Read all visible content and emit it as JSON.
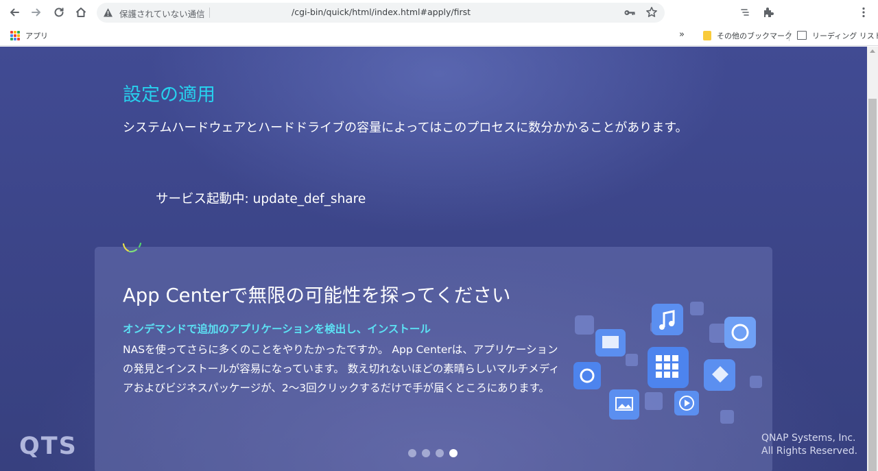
{
  "browser": {
    "security_label": "保護されていない通信",
    "url": "/cgi-bin/quick/html/index.html#apply/first",
    "bookmarks": {
      "apps_label": "アプリ",
      "overflow_label": "»",
      "other_bookmarks_label": "その他のブックマーク",
      "reading_list_label": "リーディング リスト"
    },
    "apps_icon_colors": [
      "#ea4335",
      "#fbbc04",
      "#34a853",
      "#4285f4",
      "#ea4335",
      "#fbbc04",
      "#34a853",
      "#4285f4",
      "#ea4335"
    ]
  },
  "page": {
    "heading": "設定の適用",
    "description": "システムハードウェアとハードドライブの容量によってはこのプロセスに数分かかることがあります。",
    "service_status": "サービス起動中: update_def_share",
    "card": {
      "title": "App Centerで無限の可能性を探ってください",
      "subtitle": "オンデマンドで追加のアプリケーションを検出し、インストール",
      "body": "NASを使ってさらに多くのことをやりたかったですか。 App Centerは、アプリケーションの発見とインストールが容易になっています。 数え切れないほどの素晴らしいマルチメディアおよびビジネスパッケージが、2～3回クリックするだけで手が届くところにあります。",
      "carousel": {
        "total": 4,
        "active_index": 3
      }
    },
    "logo_text": "QTS",
    "copyright_line1": "QNAP Systems, Inc.",
    "copyright_line2": "All Rights Reserved."
  },
  "colors": {
    "accent_heading": "#27d1ee",
    "accent_subtitle": "#5ce1f4",
    "background": "#3c4589"
  }
}
